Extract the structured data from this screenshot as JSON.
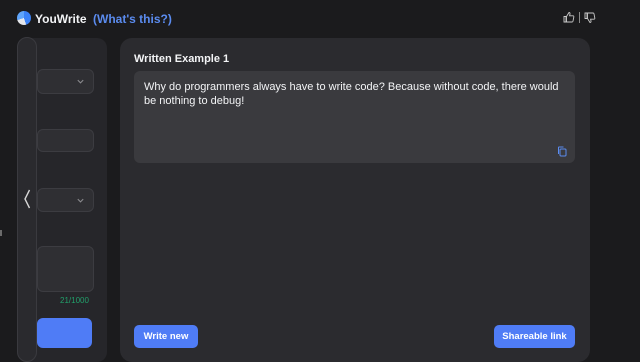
{
  "header": {
    "app_title": "YouWrite",
    "whats_this": "(What's this?)",
    "logo_icon": "youwrite-logo-icon",
    "feedback_icons": [
      "thumbs-up-icon",
      "thumbs-down-icon"
    ]
  },
  "sidebar": {
    "character_counter": "21/1000",
    "collapse_icon": "chevron-left-icon"
  },
  "main": {
    "card_title": "Written Example 1",
    "example_text": "Why do programmers always have to write code? Because without code, there would be nothing to debug!",
    "write_new_label": "Write new",
    "share_label": "Shareable link"
  },
  "colors": {
    "accent": "#4f7cf6",
    "link": "#5b8cf0",
    "background": "#1b1b1d",
    "card": "#2b2b2f",
    "counter": "#22a06b"
  }
}
